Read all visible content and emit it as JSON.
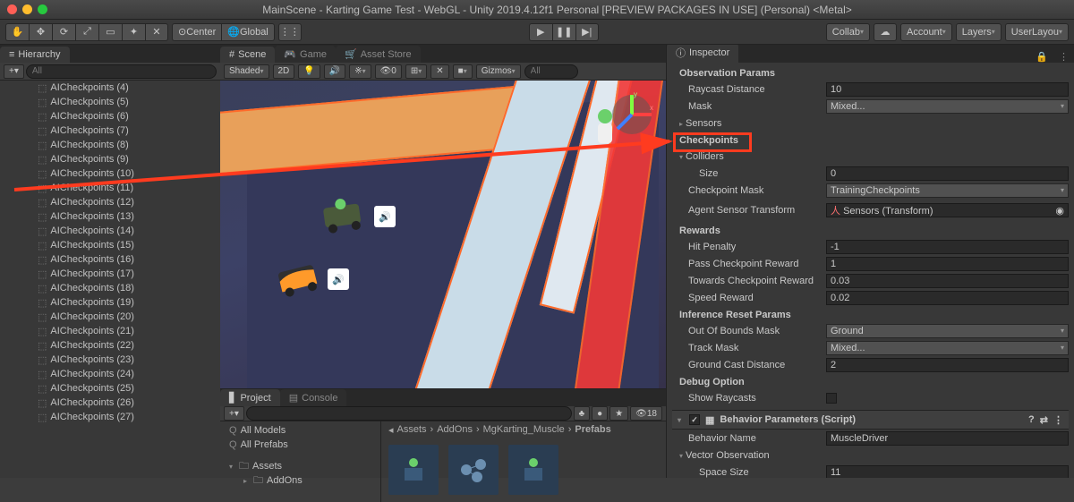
{
  "window": {
    "title": "MainScene - Karting Game Test - WebGL - Unity 2019.4.12f1 Personal [PREVIEW PACKAGES IN USE] (Personal) <Metal>"
  },
  "toolbar": {
    "center_label": "Center",
    "global_label": "Global",
    "collab_label": "Collab",
    "account_label": "Account",
    "layers_label": "Layers",
    "layout_label": "UserLayou"
  },
  "hierarchy": {
    "tab": "Hierarchy",
    "search_placeholder": "All",
    "items": [
      "AICheckpoints (4)",
      "AICheckpoints (5)",
      "AICheckpoints (6)",
      "AICheckpoints (7)",
      "AICheckpoints (8)",
      "AICheckpoints (9)",
      "AICheckpoints (10)",
      "AICheckpoints (11)",
      "AICheckpoints (12)",
      "AICheckpoints (13)",
      "AICheckpoints (14)",
      "AICheckpoints (15)",
      "AICheckpoints (16)",
      "AICheckpoints (17)",
      "AICheckpoints (18)",
      "AICheckpoints (19)",
      "AICheckpoints (20)",
      "AICheckpoints (21)",
      "AICheckpoints (22)",
      "AICheckpoints (23)",
      "AICheckpoints (24)",
      "AICheckpoints (25)",
      "AICheckpoints (26)",
      "AICheckpoints (27)"
    ]
  },
  "scene_tabs": {
    "scene": "Scene",
    "game": "Game",
    "asset_store": "Asset Store"
  },
  "scene_toolbar": {
    "shading": "Shaded",
    "mode_2d": "2D",
    "gizmos": "Gizmos",
    "search_placeholder": "All"
  },
  "project": {
    "tab_project": "Project",
    "tab_console": "Console",
    "count_badge": "18",
    "sidebar": {
      "all_models": "All Models",
      "all_prefabs": "All Prefabs",
      "assets": "Assets",
      "addons": "AddOns"
    },
    "breadcrumb": [
      "Assets",
      "AddOns",
      "MgKarting_Muscle",
      "Prefabs"
    ]
  },
  "inspector": {
    "tab": "Inspector",
    "sections": {
      "observation_params": "Observation Params",
      "raycast_distance_label": "Raycast Distance",
      "raycast_distance_value": "10",
      "mask_label": "Mask",
      "mask_value": "Mixed...",
      "sensors_label": "Sensors",
      "checkpoints_label": "Checkpoints",
      "colliders_label": "Colliders",
      "size_label": "Size",
      "size_value": "0",
      "checkpoint_mask_label": "Checkpoint Mask",
      "checkpoint_mask_value": "TrainingCheckpoints",
      "agent_sensor_transform_label": "Agent Sensor Transform",
      "agent_sensor_transform_value": "Sensors (Transform)",
      "rewards_label": "Rewards",
      "hit_penalty_label": "Hit Penalty",
      "hit_penalty_value": "-1",
      "pass_checkpoint_reward_label": "Pass Checkpoint Reward",
      "pass_checkpoint_reward_value": "1",
      "towards_checkpoint_reward_label": "Towards Checkpoint Reward",
      "towards_checkpoint_reward_value": "0.03",
      "speed_reward_label": "Speed Reward",
      "speed_reward_value": "0.02",
      "inference_reset_label": "Inference Reset Params",
      "out_of_bounds_mask_label": "Out Of Bounds Mask",
      "out_of_bounds_mask_value": "Ground",
      "track_mask_label": "Track Mask",
      "track_mask_value": "Mixed...",
      "ground_cast_distance_label": "Ground Cast Distance",
      "ground_cast_distance_value": "2",
      "debug_option_label": "Debug Option",
      "show_raycasts_label": "Show Raycasts",
      "behavior_params_label": "Behavior Parameters (Script)",
      "behavior_name_label": "Behavior Name",
      "behavior_name_value": "MuscleDriver",
      "vector_observation_label": "Vector Observation",
      "space_size_label": "Space Size",
      "space_size_value": "11"
    }
  },
  "annotation": {
    "target": "Colliders"
  }
}
